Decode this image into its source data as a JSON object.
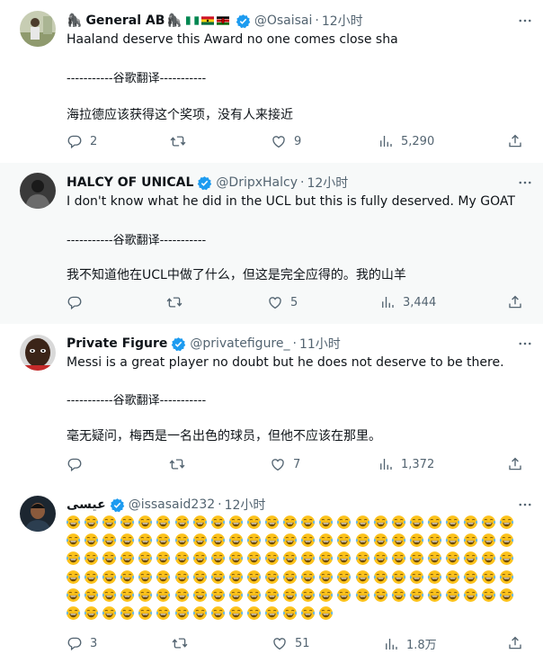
{
  "tweets": [
    {
      "name": "General AB",
      "handle": "@Osaisai",
      "time": "12小时",
      "text": "Haaland deserve this Award no one comes close sha",
      "separator": "-----------谷歌翻译-----------",
      "translation": "海拉德应该获得这个奖项，没有人来接近",
      "replies": "2",
      "retweets": "",
      "likes": "9",
      "views": "5,290"
    },
    {
      "name": "HALCY OF UNICAL",
      "handle": "@DripxHalcy",
      "time": "12小时",
      "text": "I don't know what he did in the UCL but this is fully deserved. My GOAT",
      "separator": "-----------谷歌翻译-----------",
      "translation": "我不知道他在UCL中做了什么，但这是完全应得的。我的山羊",
      "replies": "",
      "retweets": "",
      "likes": "5",
      "views": "3,444"
    },
    {
      "name": "Private Figure",
      "handle": "@privatefigure_",
      "time": "11小时",
      "text": "Messi is a great player no doubt but he does not deserve to be there.",
      "separator": "-----------谷歌翻译-----------",
      "translation": "毫无疑问，梅西是一名出色的球员，但他不应该在那里。",
      "replies": "",
      "retweets": "",
      "likes": "7",
      "views": "1,372"
    },
    {
      "name": "عيسى",
      "handle": "@issasaid232",
      "time": "12小时",
      "emoji_name": "face-with-tears-of-joy",
      "emoji_rows": [
        25,
        25,
        25,
        25,
        25,
        15
      ],
      "replies": "3",
      "retweets": "",
      "likes": "51",
      "views": "1.8万"
    }
  ],
  "colors": {
    "verified": "#1d9bf0",
    "muted": "#536471",
    "text": "#0f1419",
    "highlight_bg": "#f7f9f9",
    "emoji_face": "#fcc21b",
    "emoji_tear": "#5fb8f0"
  },
  "icons": {
    "reply": "reply-icon",
    "retweet": "retweet-icon",
    "like": "heart-icon",
    "views": "views-icon",
    "share": "share-icon",
    "more": "more-icon",
    "verified": "verified-badge-icon"
  }
}
